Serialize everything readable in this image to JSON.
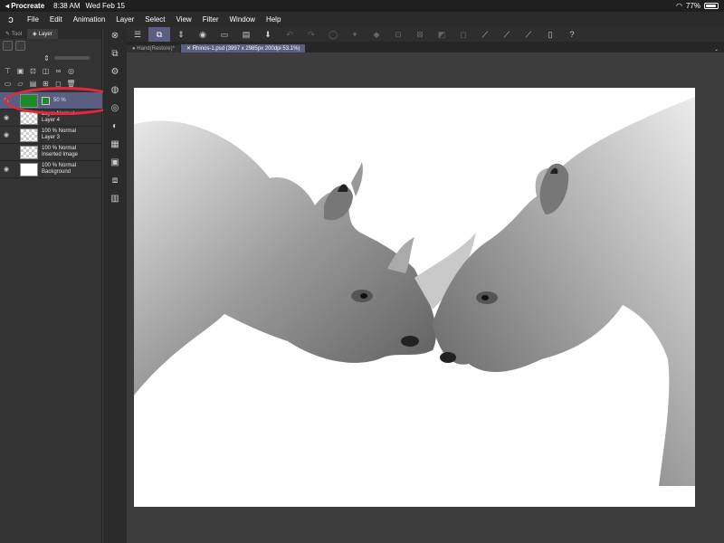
{
  "status_bar": {
    "back": "◂ Procreate",
    "time": "8:38 AM",
    "date": "Wed Feb 15",
    "battery": "77%"
  },
  "menu": {
    "items": [
      "File",
      "Edit",
      "Animation",
      "Layer",
      "Select",
      "View",
      "Filter",
      "Window",
      "Help"
    ]
  },
  "layer_panel": {
    "tabs": [
      "Tool",
      "Layer"
    ],
    "layers": [
      {
        "line1": "50 %",
        "line2": "",
        "thumb": "green",
        "selected": true
      },
      {
        "line1": "Layer Normal",
        "line2": "Layer 4",
        "thumb": "checker",
        "selected": false
      },
      {
        "line1": "100 %  Normal",
        "line2": "Layer 3",
        "thumb": "checker",
        "selected": false
      },
      {
        "line1": "100 %  Normal",
        "line2": "Inserted Image",
        "thumb": "checker",
        "selected": false
      },
      {
        "line1": "100 %  Normal",
        "line2": "Background",
        "thumb": "white",
        "selected": false
      }
    ]
  },
  "doc_tabs": [
    "Hand(Restore)*",
    "Rhinos-1.psd (3997 x 2985px 200dpi 53.1%)"
  ],
  "colors": {
    "highlight_oval": "#e6283c",
    "selection": "#5a5e80",
    "layer_green": "#1d8a2a"
  }
}
